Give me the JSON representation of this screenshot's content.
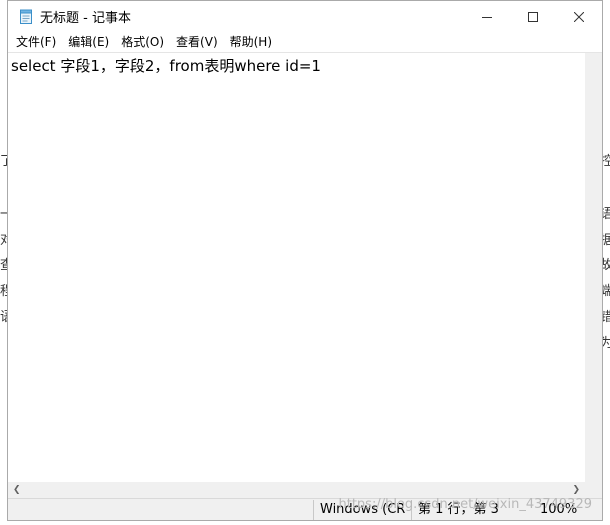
{
  "background": {
    "left_fragments": [
      "了",
      "一",
      "对",
      "查",
      "程",
      "语"
    ],
    "right_fragments": [
      "控",
      "语",
      "据",
      "故",
      "端",
      "错",
      "为"
    ]
  },
  "window": {
    "title": "无标题 - 记事本",
    "controls": {
      "minimize": "—",
      "maximize": "☐",
      "close": "✕"
    }
  },
  "menu": [
    {
      "label": "文件(F)"
    },
    {
      "label": "编辑(E)"
    },
    {
      "label": "格式(O)"
    },
    {
      "label": "查看(V)"
    },
    {
      "label": "帮助(H)"
    }
  ],
  "editor": {
    "content": "select 字段1，字段2，from表明where id=1"
  },
  "statusbar": {
    "encoding": "Windows (CR",
    "position": "第 1 行，第 3",
    "zoom": "100%"
  },
  "watermark": "https://blog.csdn.net/weixin_43749329"
}
